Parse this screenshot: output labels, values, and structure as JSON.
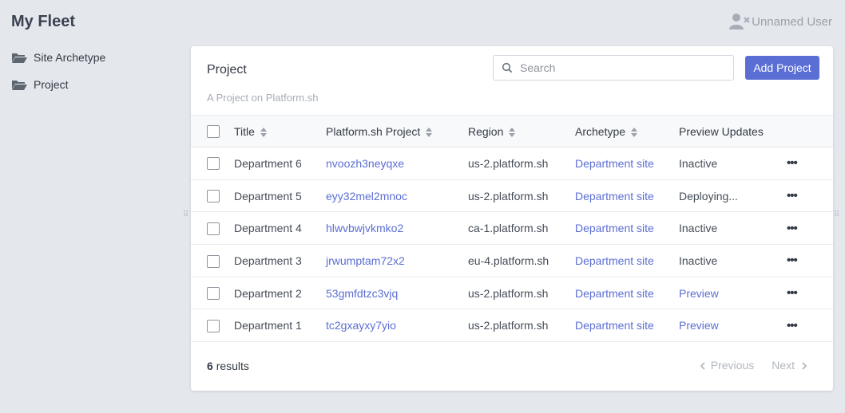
{
  "app": {
    "title": "My Fleet"
  },
  "user": {
    "name": "Unnamed User",
    "icon": "user-x-icon"
  },
  "sidebar": {
    "items": [
      {
        "label": "Site Archetype",
        "icon": "folder-open-icon"
      },
      {
        "label": "Project",
        "icon": "folder-open-icon"
      }
    ]
  },
  "panel": {
    "title": "Project",
    "subtitle": "A Project on Platform.sh",
    "search_placeholder": "Search",
    "add_button": "Add Project"
  },
  "table": {
    "columns": [
      "Title",
      "Platform.sh Project",
      "Region",
      "Archetype",
      "Preview Updates"
    ],
    "rows": [
      {
        "title": "Department 6",
        "project": "nvoozh3neyqxe",
        "region": "us-2.platform.sh",
        "archetype": "Department site",
        "preview": "Inactive"
      },
      {
        "title": "Department 5",
        "project": "eyy32mel2mnoc",
        "region": "us-2.platform.sh",
        "archetype": "Department site",
        "preview": "Deploying..."
      },
      {
        "title": "Department 4",
        "project": "hlwvbwjvkmko2",
        "region": "ca-1.platform.sh",
        "archetype": "Department site",
        "preview": "Inactive"
      },
      {
        "title": "Department 3",
        "project": "jrwumptam72x2",
        "region": "eu-4.platform.sh",
        "archetype": "Department site",
        "preview": "Inactive"
      },
      {
        "title": "Department 2",
        "project": "53gmfdtzc3vjq",
        "region": "us-2.platform.sh",
        "archetype": "Department site",
        "preview": "Preview"
      },
      {
        "title": "Department 1",
        "project": "tc2gxayxy7yio",
        "region": "us-2.platform.sh",
        "archetype": "Department site",
        "preview": "Preview"
      }
    ],
    "row_menu": "•••"
  },
  "footer": {
    "count": "6",
    "count_suffix": "results",
    "previous": "Previous",
    "next": "Next"
  },
  "colors": {
    "accent": "#5b6ed4",
    "background": "#e4e7ec"
  }
}
